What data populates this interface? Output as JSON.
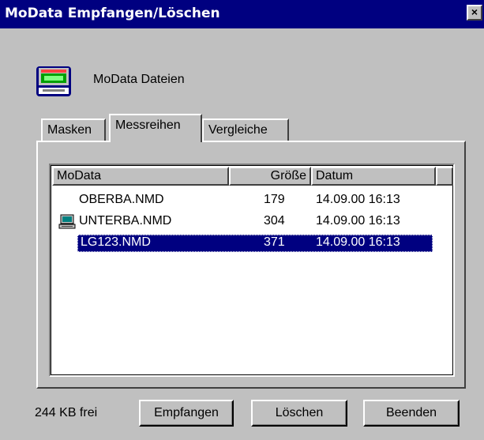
{
  "window": {
    "title": "MoData Empfangen/Löschen",
    "close_glyph": "×"
  },
  "header": {
    "icon": "modata-device-icon",
    "label": "MoData Dateien"
  },
  "tabs": [
    {
      "label": "Masken",
      "active": false
    },
    {
      "label": "Messreihen",
      "active": true
    },
    {
      "label": "Vergleiche",
      "active": false
    }
  ],
  "list": {
    "columns": [
      "MoData",
      "Größe",
      "Datum"
    ],
    "rows": [
      {
        "name": "OBERBA.NMD",
        "size": "179",
        "date": "14.09.00 16:13",
        "icon": "",
        "selected": false
      },
      {
        "name": "UNTERBA.NMD",
        "size": "304",
        "date": "14.09.00 16:13",
        "icon": "computer-icon",
        "selected": false
      },
      {
        "name": "LG123.NMD",
        "size": "371",
        "date": "14.09.00 16:13",
        "icon": "",
        "selected": true
      }
    ]
  },
  "footer": {
    "free_space": "244 KB frei",
    "receive_label": "Empfangen",
    "delete_label": "Löschen",
    "exit_label": "Beenden"
  },
  "colors": {
    "titlebar": "#000080",
    "face": "#c0c0c0",
    "selection": "#000080"
  }
}
